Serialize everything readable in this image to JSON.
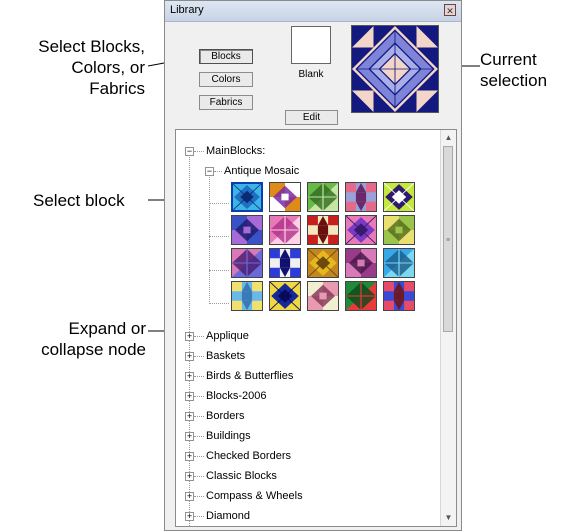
{
  "callouts": {
    "select_sources": [
      "Select Blocks,",
      "Colors, or",
      "Fabrics"
    ],
    "current_selection": [
      "Current",
      "selection"
    ],
    "select_block": "Select block",
    "expand_collapse": [
      "Expand or",
      "collapse node"
    ]
  },
  "panel": {
    "title": "Library",
    "close_glyph": "✕",
    "buttons": {
      "blocks": "Blocks",
      "colors": "Colors",
      "fabrics": "Fabrics",
      "edit": "Edit"
    },
    "blank_label": "Blank"
  },
  "tree": {
    "root_label": "MainBlocks:",
    "root_expander": "−",
    "open_category": {
      "label": "Antique Mosaic",
      "expander": "−"
    },
    "collapsed_expander": "+",
    "categories": [
      "Applique",
      "Baskets",
      "Birds & Butterflies",
      "Blocks-2006",
      "Borders",
      "Buildings",
      "Checked Borders",
      "Classic Blocks",
      "Compass & Wheels",
      "Diamond"
    ],
    "block_count": 20
  },
  "colors": {
    "current_bg": "#f3d6c8",
    "current_dark": "#13197e",
    "current_mid": "#7d84d9",
    "current_light": "#a8aee8"
  }
}
